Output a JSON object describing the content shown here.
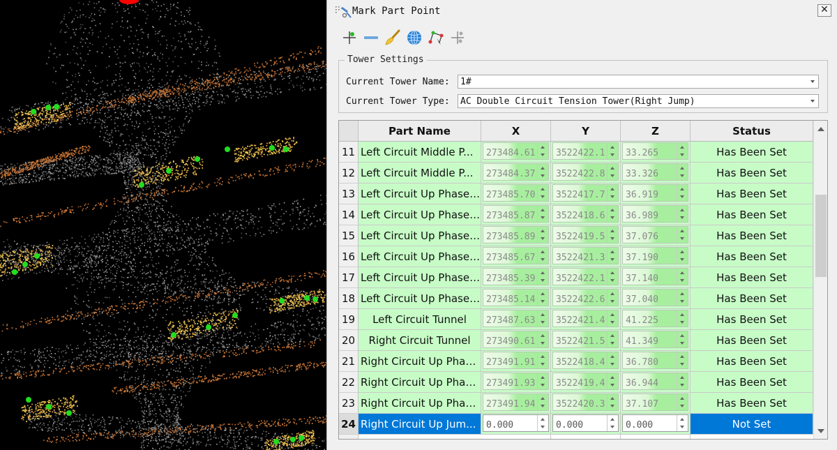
{
  "window": {
    "title": "Mark Part Point",
    "close_label": "✕"
  },
  "toolbar": {
    "tools": [
      {
        "icon": "crosshair-add-icon"
      },
      {
        "icon": "line-icon"
      },
      {
        "icon": "brush-icon"
      },
      {
        "icon": "globe-icon"
      },
      {
        "icon": "connect-points-icon"
      },
      {
        "icon": "move-points-icon"
      }
    ]
  },
  "tower_settings": {
    "title": "Tower Settings",
    "name_label": "Current Tower Name:",
    "name_value": "1#",
    "type_label": "Current Tower Type:",
    "type_value": "AC Double Circuit Tension Tower(Right Jump)"
  },
  "table": {
    "headers": {
      "name": "Part Name",
      "x": "X",
      "y": "Y",
      "z": "Z",
      "status": "Status"
    },
    "rows": [
      {
        "num": "11",
        "name": "Left Circuit Middle P...",
        "x": "273484.61",
        "y": "3522422.1",
        "z": "33.265",
        "status": "Has Been Set"
      },
      {
        "num": "12",
        "name": "Left Circuit Middle P...",
        "x": "273484.37",
        "y": "3522422.8",
        "z": "33.326",
        "status": "Has Been Set"
      },
      {
        "num": "13",
        "name": "Left Circuit Up Phase ...",
        "x": "273485.70",
        "y": "3522417.7",
        "z": "36.919",
        "status": "Has Been Set"
      },
      {
        "num": "14",
        "name": "Left Circuit Up Phase ...",
        "x": "273485.87",
        "y": "3522418.6",
        "z": "36.989",
        "status": "Has Been Set"
      },
      {
        "num": "15",
        "name": "Left Circuit Up Phase ...",
        "x": "273485.89",
        "y": "3522419.5",
        "z": "37.076",
        "status": "Has Been Set"
      },
      {
        "num": "16",
        "name": "Left Circuit Up Phase ...",
        "x": "273485.67",
        "y": "3522421.3",
        "z": "37.190",
        "status": "Has Been Set"
      },
      {
        "num": "17",
        "name": "Left Circuit Up Phase ...",
        "x": "273485.39",
        "y": "3522422.1",
        "z": "37.140",
        "status": "Has Been Set"
      },
      {
        "num": "18",
        "name": "Left Circuit Up Phase ...",
        "x": "273485.14",
        "y": "3522422.6",
        "z": "37.040",
        "status": "Has Been Set"
      },
      {
        "num": "19",
        "name": "Left Circuit Tunnel",
        "x": "273487.63",
        "y": "3522421.4",
        "z": "41.225",
        "status": "Has Been Set"
      },
      {
        "num": "20",
        "name": "Right Circuit Tunnel",
        "x": "273490.61",
        "y": "3522421.5",
        "z": "41.349",
        "status": "Has Been Set"
      },
      {
        "num": "21",
        "name": "Right Circuit Up Phas...",
        "x": "273491.91",
        "y": "3522418.4",
        "z": "36.780",
        "status": "Has Been Set"
      },
      {
        "num": "22",
        "name": "Right Circuit Up Phas...",
        "x": "273491.93",
        "y": "3522419.4",
        "z": "36.944",
        "status": "Has Been Set"
      },
      {
        "num": "23",
        "name": "Right Circuit Up Phas...",
        "x": "273491.94",
        "y": "3522420.3",
        "z": "37.107",
        "status": "Has Been Set"
      },
      {
        "num": "24",
        "name": "Right Circuit Up Jum...",
        "x": "0.000",
        "y": "0.000",
        "z": "0.000",
        "status": "Not Set"
      }
    ]
  },
  "colors": {
    "set_row": "#c7fcc7",
    "selected_row": "#0078d7",
    "point_marker": "#22dd22",
    "point_cloud_gray": "#8a8a8a",
    "point_cloud_orange": "#d4803a",
    "point_cloud_yellow": "#e8c04a",
    "marker_red": "#ff0000"
  }
}
